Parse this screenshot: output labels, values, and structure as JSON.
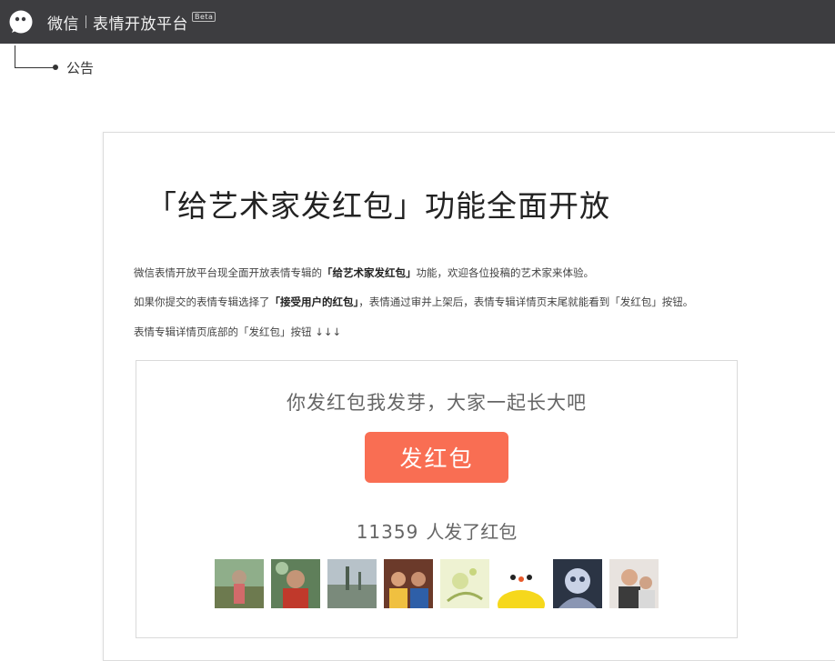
{
  "header": {
    "app_name": "微信",
    "platform_name": "表情开放平台",
    "beta_badge": "Beta"
  },
  "breadcrumb": {
    "current": "公告"
  },
  "announcement": {
    "title": "「给艺术家发红包」功能全面开放",
    "paragraph1": {
      "before": "微信表情开放平台现全面开放表情专辑的",
      "highlight": "「给艺术家发红包」",
      "after": "功能，欢迎各位投稿的艺术家来体验。"
    },
    "paragraph2": {
      "before": "如果你提交的表情专辑选择了",
      "highlight": "「接受用户的红包」",
      "after": "，表情通过审并上架后，表情专辑详情页末尾就能看到「发红包」按钮。"
    },
    "paragraph3": "表情专辑详情页底部的「发红包」按钮 ↓↓↓"
  },
  "preview": {
    "slogan": "你发红包我发芽，大家一起长大吧",
    "button_label": "发红包",
    "sender_count": "11359",
    "sender_suffix": "人发了红包",
    "avatars": [
      {
        "name": "avatar-1"
      },
      {
        "name": "avatar-2"
      },
      {
        "name": "avatar-3"
      },
      {
        "name": "avatar-4"
      },
      {
        "name": "avatar-5"
      },
      {
        "name": "avatar-6"
      },
      {
        "name": "avatar-7"
      },
      {
        "name": "avatar-8"
      }
    ]
  },
  "colors": {
    "topbar": "#3d3d40",
    "red_packet_button": "#f96e53"
  }
}
